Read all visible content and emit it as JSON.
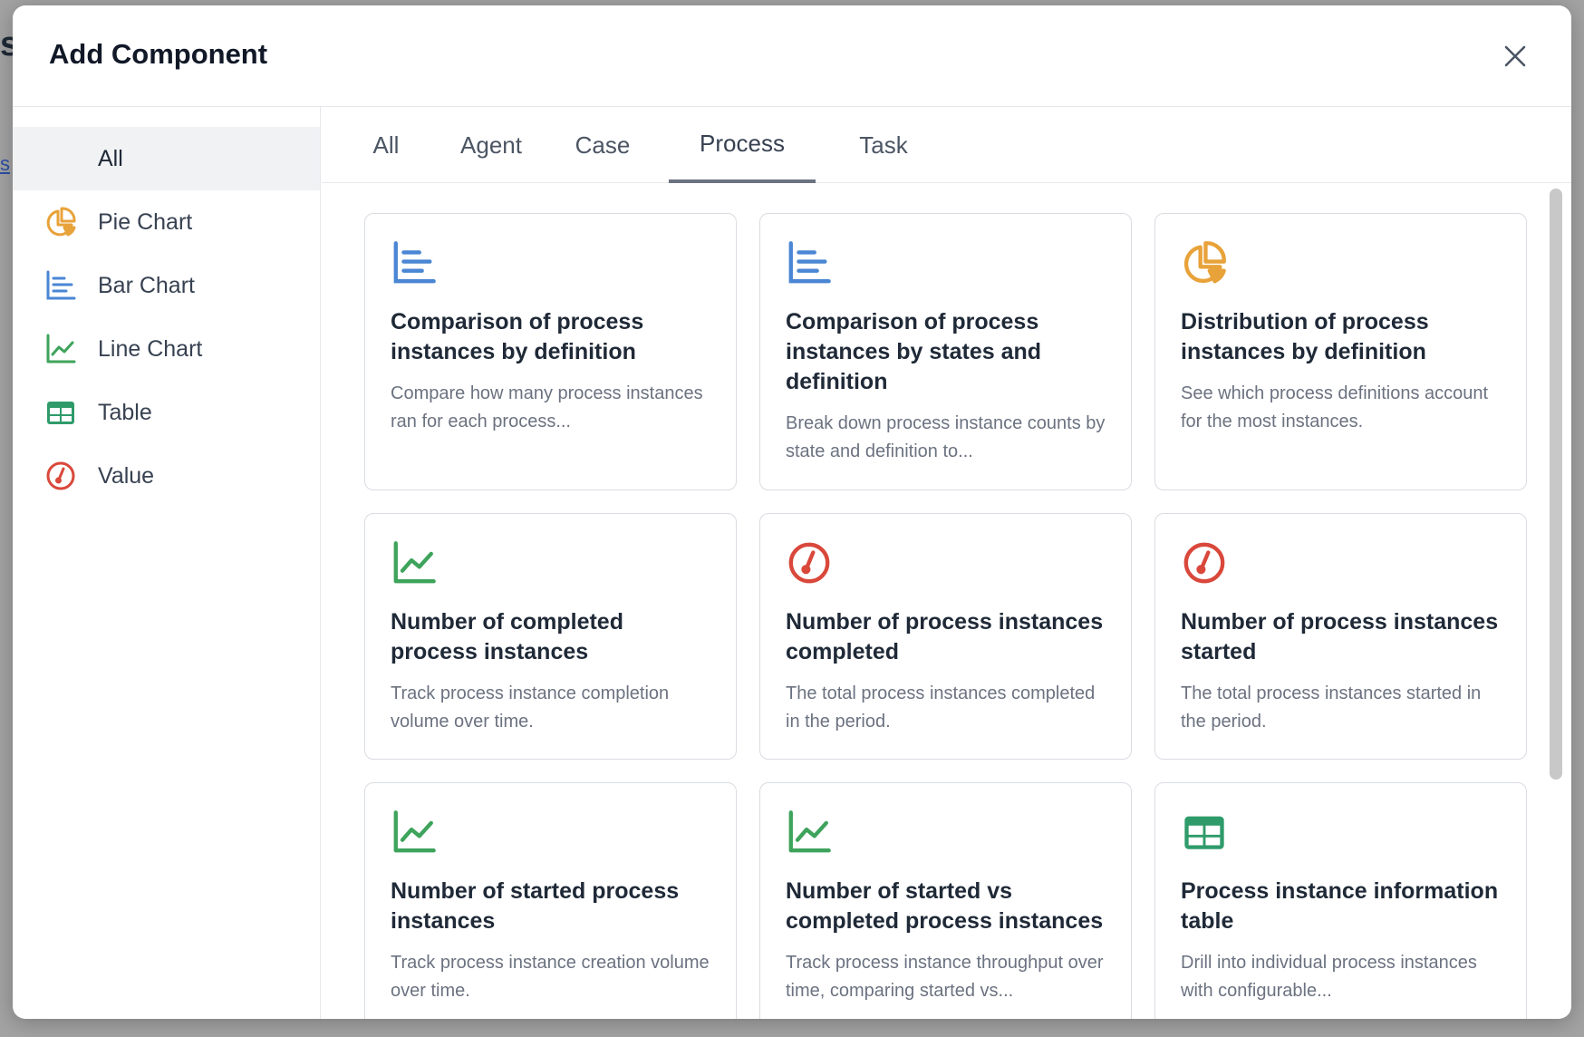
{
  "background": {
    "letter": "s",
    "link": "s"
  },
  "modal": {
    "title": "Add Component",
    "close_icon": "close-icon"
  },
  "sidebar": {
    "items": [
      {
        "label": "All",
        "icon": "",
        "active": true
      },
      {
        "label": "Pie Chart",
        "icon": "pie-chart-icon",
        "color": "#e8a23a"
      },
      {
        "label": "Bar Chart",
        "icon": "bar-chart-icon",
        "color": "#4a86d4"
      },
      {
        "label": "Line Chart",
        "icon": "line-chart-icon",
        "color": "#3ea35b"
      },
      {
        "label": "Table",
        "icon": "table-icon",
        "color": "#2f9b6a"
      },
      {
        "label": "Value",
        "icon": "gauge-icon",
        "color": "#d9483b"
      }
    ]
  },
  "tabs": [
    {
      "label": "All"
    },
    {
      "label": "Agent"
    },
    {
      "label": "Case"
    },
    {
      "label": "Process",
      "active": true
    },
    {
      "label": "Task"
    }
  ],
  "cards": [
    {
      "icon": "bar-chart-icon",
      "title": "Comparison of process instances by definition",
      "desc": "Compare how many process instances ran for each process..."
    },
    {
      "icon": "bar-chart-icon",
      "title": "Comparison of process instances by states and definition",
      "desc": "Break down process instance counts by state and definition to..."
    },
    {
      "icon": "pie-chart-icon",
      "title": "Distribution of process instances by definition",
      "desc": "See which process definitions account for the most instances."
    },
    {
      "icon": "line-chart-icon",
      "title": "Number of completed process instances",
      "desc": "Track process instance completion volume over time."
    },
    {
      "icon": "gauge-icon",
      "title": "Number of process instances completed",
      "desc": "The total process instances completed in the period."
    },
    {
      "icon": "gauge-icon",
      "title": "Number of process instances started",
      "desc": "The total process instances started in the period."
    },
    {
      "icon": "line-chart-icon",
      "title": "Number of started process instances",
      "desc": "Track process instance creation volume over time."
    },
    {
      "icon": "line-chart-icon",
      "title": "Number of started vs completed process instances",
      "desc": "Track process instance throughput over time, comparing started vs..."
    },
    {
      "icon": "table-icon",
      "title": "Process instance information table",
      "desc": "Drill into individual process instances with configurable..."
    }
  ],
  "colors": {
    "pie": "#e8a23a",
    "bar": "#4a86d4",
    "line": "#3ea35b",
    "table": "#2f9b6a",
    "gauge": "#d9483b"
  }
}
